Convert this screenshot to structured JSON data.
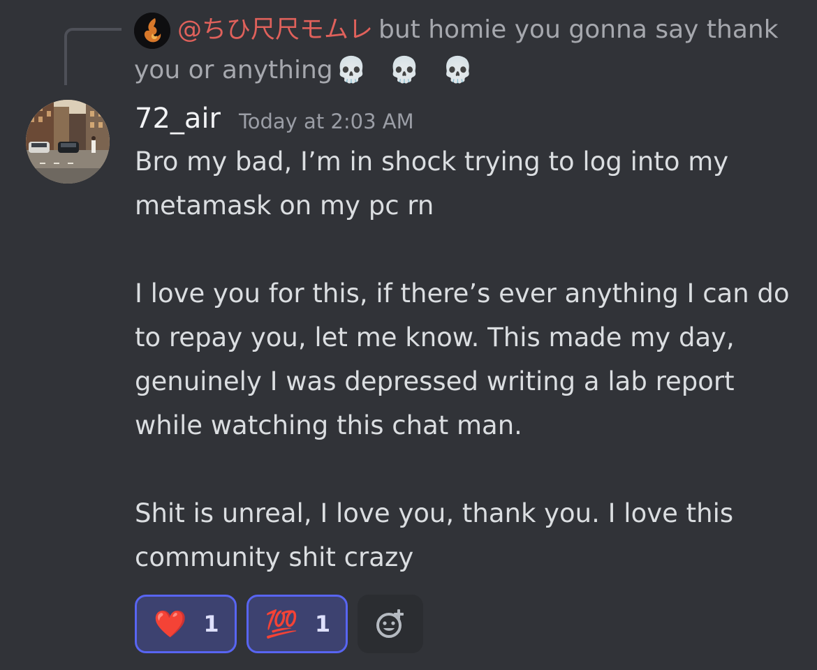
{
  "reply": {
    "author": "@ちひ尺尺モムレ",
    "text": "but homie you gonna say thank you or anything",
    "trailing_emoji": "💀 💀 💀"
  },
  "message": {
    "username": "72_air",
    "timestamp": "Today at 2:03 AM",
    "paragraphs": [
      "Bro my bad, I’m in shock trying to log into my metamask on my pc rn",
      "I love you for this, if there’s ever anything I can do to repay you, let me know. This made my day, genuinely I was depressed writing a lab report while watching this chat man.",
      "Shit is unreal, I love you, thank you. I love this community shit crazy"
    ]
  },
  "reactions": [
    {
      "emoji": "❤️",
      "count": "1",
      "icon": "red-heart-emoji"
    },
    {
      "emoji": "💯",
      "count": "1",
      "icon": "hundred-points-emoji"
    }
  ],
  "add_reaction": {
    "icon": "add-reaction-icon"
  },
  "colors": {
    "background": "#313338",
    "reply_author": "#e0615b",
    "reaction_bg": "#3d4270",
    "reaction_border": "#5865f2"
  }
}
